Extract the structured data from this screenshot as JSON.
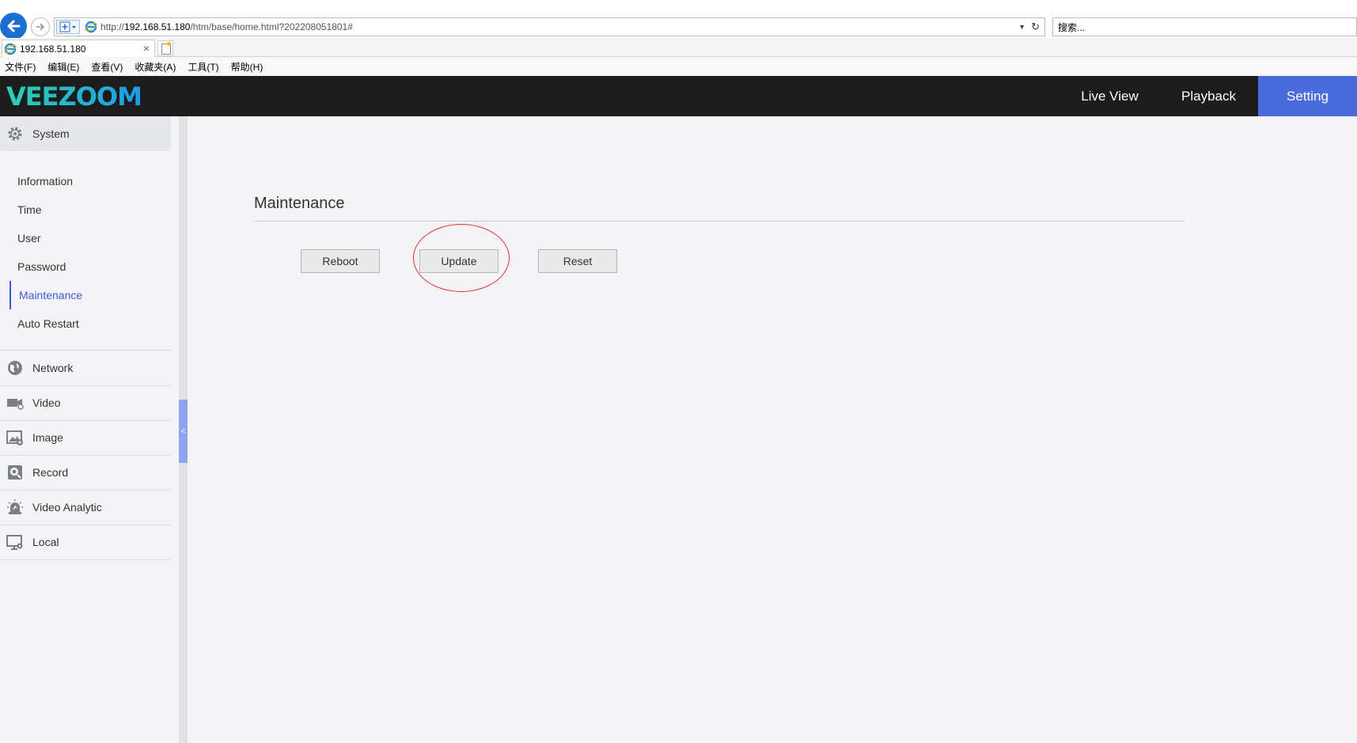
{
  "browser": {
    "url_prefix": "http://",
    "url_host": "192.168.51.180",
    "url_path": "/htm/base/home.html?202208051801#",
    "search_placeholder": "搜索...",
    "tab_title": "192.168.51.180",
    "tab_close": "×",
    "menu": [
      "文件(F)",
      "编辑(E)",
      "查看(V)",
      "收藏夹(A)",
      "工具(T)",
      "帮助(H)"
    ]
  },
  "app": {
    "brand": "VEEZOOM",
    "brand_color": "#1fa9e6",
    "accent_color": "#4a6cdb",
    "nav": [
      {
        "label": "Live View",
        "active": false
      },
      {
        "label": "Playback",
        "active": false
      },
      {
        "label": "Setting",
        "active": true
      }
    ]
  },
  "sidebar": {
    "system": {
      "label": "System",
      "icon": "gear-icon",
      "items": [
        "Information",
        "Time",
        "User",
        "Password",
        "Maintenance",
        "Auto Restart"
      ],
      "active_item": "Maintenance"
    },
    "sections": [
      {
        "label": "Network",
        "icon": "globe-icon"
      },
      {
        "label": "Video",
        "icon": "video-camera-icon"
      },
      {
        "label": "Image",
        "icon": "image-settings-icon"
      },
      {
        "label": "Record",
        "icon": "record-icon"
      },
      {
        "label": "Video Analytic",
        "icon": "alarm-light-icon"
      },
      {
        "label": "Local",
        "icon": "monitor-icon"
      }
    ],
    "collapse_glyph": "<"
  },
  "main": {
    "title": "Maintenance",
    "buttons": [
      "Reboot",
      "Update",
      "Reset"
    ]
  }
}
